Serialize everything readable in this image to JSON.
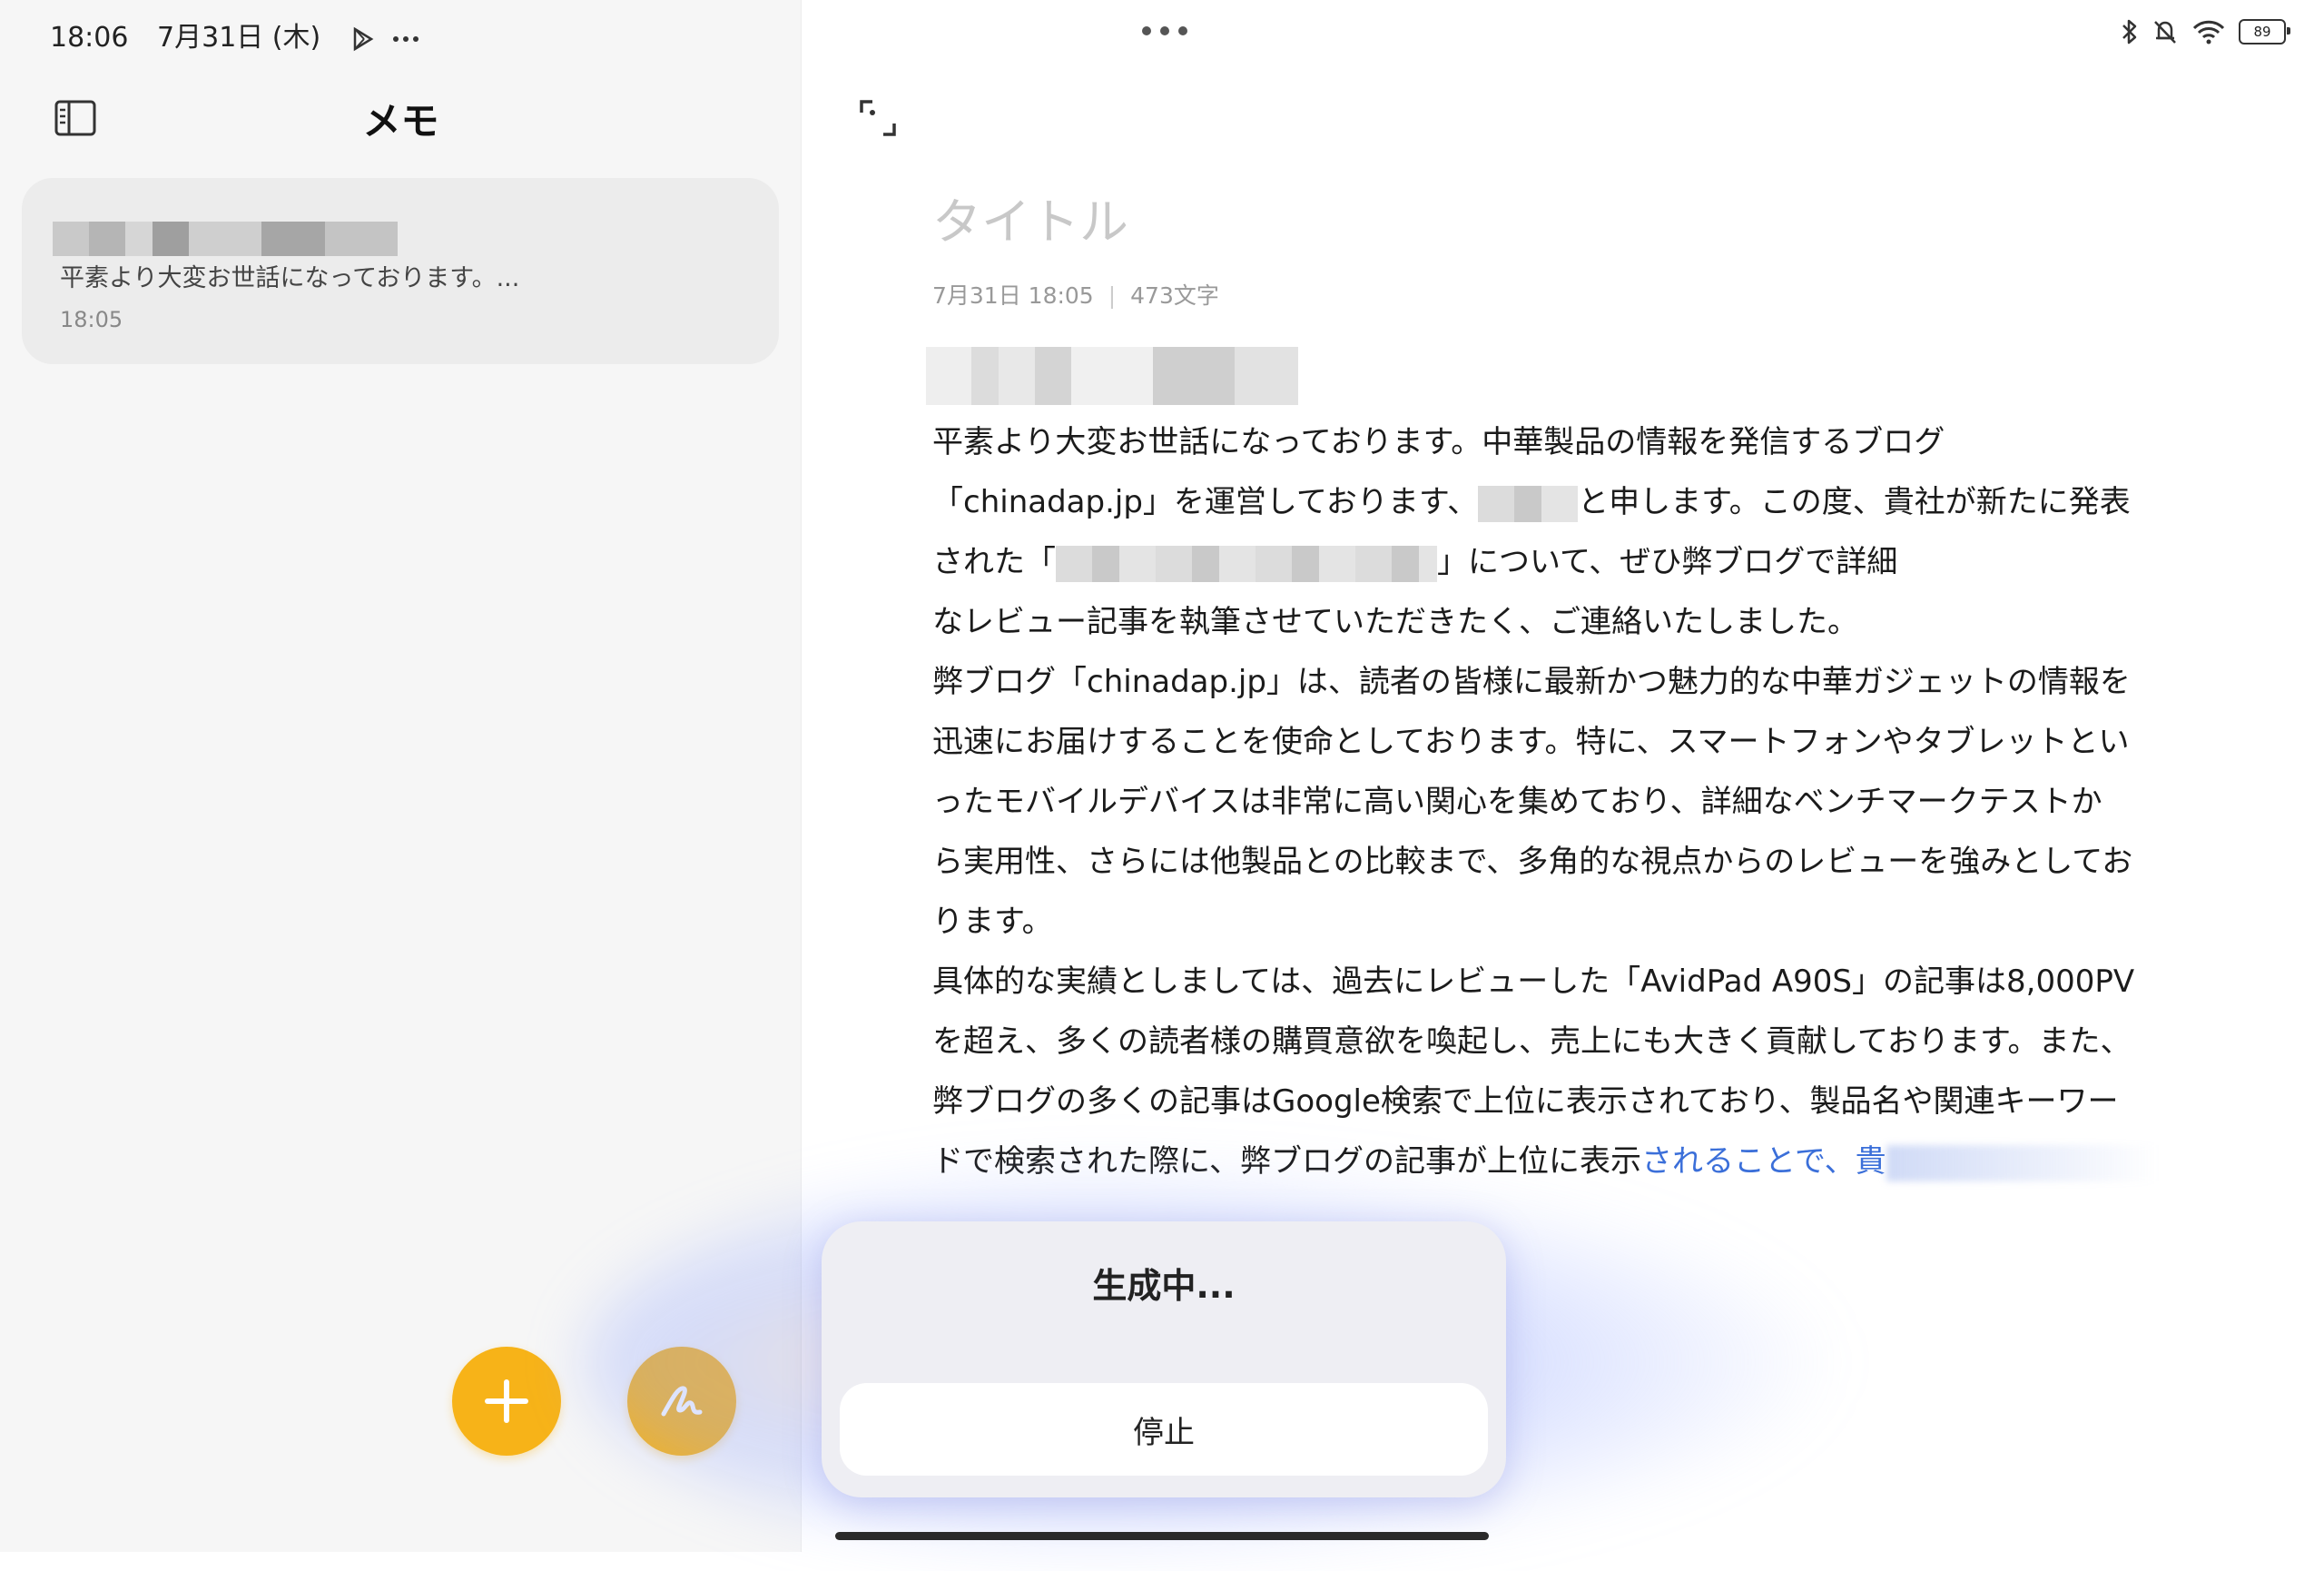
{
  "status_bar": {
    "time": "18:06",
    "date": "7月31日 (木)",
    "battery": "89",
    "icons": [
      "play-store-icon",
      "more-icon",
      "bluetooth-icon",
      "mute-icon",
      "wifi-icon",
      "battery-icon"
    ]
  },
  "sidebar": {
    "title": "メモ",
    "notes": [
      {
        "snippet": "平素より大変お世話になっております。...",
        "time": "18:05"
      }
    ]
  },
  "editor": {
    "title_placeholder": "タイトル",
    "meta_date": "7月31日 18:05",
    "meta_sep": "|",
    "meta_count": "473文字",
    "lines": {
      "l1": "平素より大変お世話になっております。中華製品の情報を発信するブログ",
      "l2a": "「chinadap.jp」を運営しております、",
      "l2b": "と申します。この度、貴社が新たに発表",
      "l3a": "された「",
      "l3b": "」について、ぜひ弊ブログで詳細",
      "l4": "なレビュー記事を執筆させていただきたく、ご連絡いたしました。",
      "l5": "弊ブログ「chinadap.jp」は、読者の皆様に最新かつ魅力的な中華ガジェットの情報を",
      "l6": "迅速にお届けすることを使命としております。特に、スマートフォンやタブレットとい",
      "l7": "ったモバイルデバイスは非常に高い関心を集めており、詳細なベンチマークテストか",
      "l8": "ら実用性、さらには他製品との比較まで、多角的な視点からのレビューを強みとしてお",
      "l9": "ります。",
      "l10": "具体的な実績としましては、過去にレビューした「AvidPad A90S」の記事は8,000PV",
      "l11": "を超え、多くの読者様の購買意欲を喚起し、売上にも大きく貢献しております。また、",
      "l12": "弊ブログの多くの記事はGoogle検索で上位に表示されており、製品名や関連キーワー",
      "l13a": "ドで検索された際に、弊ブログの記事が上位に表示",
      "l13b": "されることで、貴"
    }
  },
  "ai_panel": {
    "status": "生成中...",
    "stop_label": "停止"
  },
  "colors": {
    "accent": "#f7b318",
    "streaming_text": "#3b6fd9"
  }
}
